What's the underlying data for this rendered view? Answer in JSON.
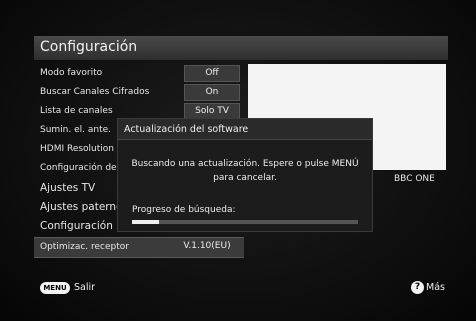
{
  "header": {
    "title": "Configuración"
  },
  "menu": {
    "items": [
      {
        "label": "Modo favorito",
        "value": "Off"
      },
      {
        "label": "Buscar Canales Cifrados",
        "value": "On"
      },
      {
        "label": "Lista de canales",
        "value": "Solo TV"
      },
      {
        "label": "Sumin. el. ante.",
        "value": ""
      },
      {
        "label": "HDMI Resolution",
        "value": ""
      },
      {
        "label": "Configuración de",
        "value": ""
      },
      {
        "label": "Ajustes TV",
        "value": ""
      },
      {
        "label": "Ajustes paternos",
        "value": ""
      },
      {
        "label": "Configuración horaria",
        "value": ""
      },
      {
        "label": "Optimizac. receptor",
        "value": "V.1.10(EU)"
      }
    ]
  },
  "preview": {
    "channel": "BBC ONE"
  },
  "dialog": {
    "title": "Actualización del software",
    "message": "Buscando una actualización. Espere o pulse MENÚ para cancelar.",
    "progress_label": "Progreso de búsqueda:",
    "progress_fraction": 0.12
  },
  "footer": {
    "menu_button": "MENU",
    "exit_label": "Salir",
    "help_button": "?",
    "more_label": "Más"
  }
}
